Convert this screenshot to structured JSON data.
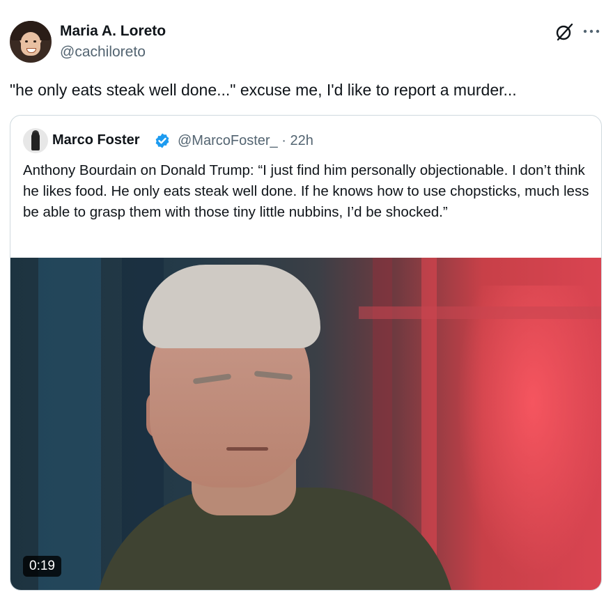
{
  "tweet": {
    "author": {
      "display_name": "Maria A. Loreto",
      "handle": "@cachiloreto",
      "avatar_icon": "avatar-photo"
    },
    "text": "\"he only eats steak well done...\" excuse me, I'd like to report a murder...",
    "actions": {
      "grok_icon": "grok-icon",
      "more_icon": "more-icon"
    }
  },
  "quote": {
    "author": {
      "display_name": "Marco Foster",
      "handle_time": "@MarcoFoster_ · 22h",
      "verified": true,
      "verified_color": "#1d9bf0"
    },
    "text": "Anthony Bourdain on Donald Trump: “I just find him personally objectionable. I don’t think he likes food. He only eats steak well done. If he knows how to use chopsticks, much less be able to grasp them with those tiny little nubbins, I’d be shocked.”",
    "video": {
      "duration": "0:19"
    }
  },
  "colors": {
    "text_primary": "#0f1419",
    "text_secondary": "#536471",
    "border": "#cfd9de"
  }
}
